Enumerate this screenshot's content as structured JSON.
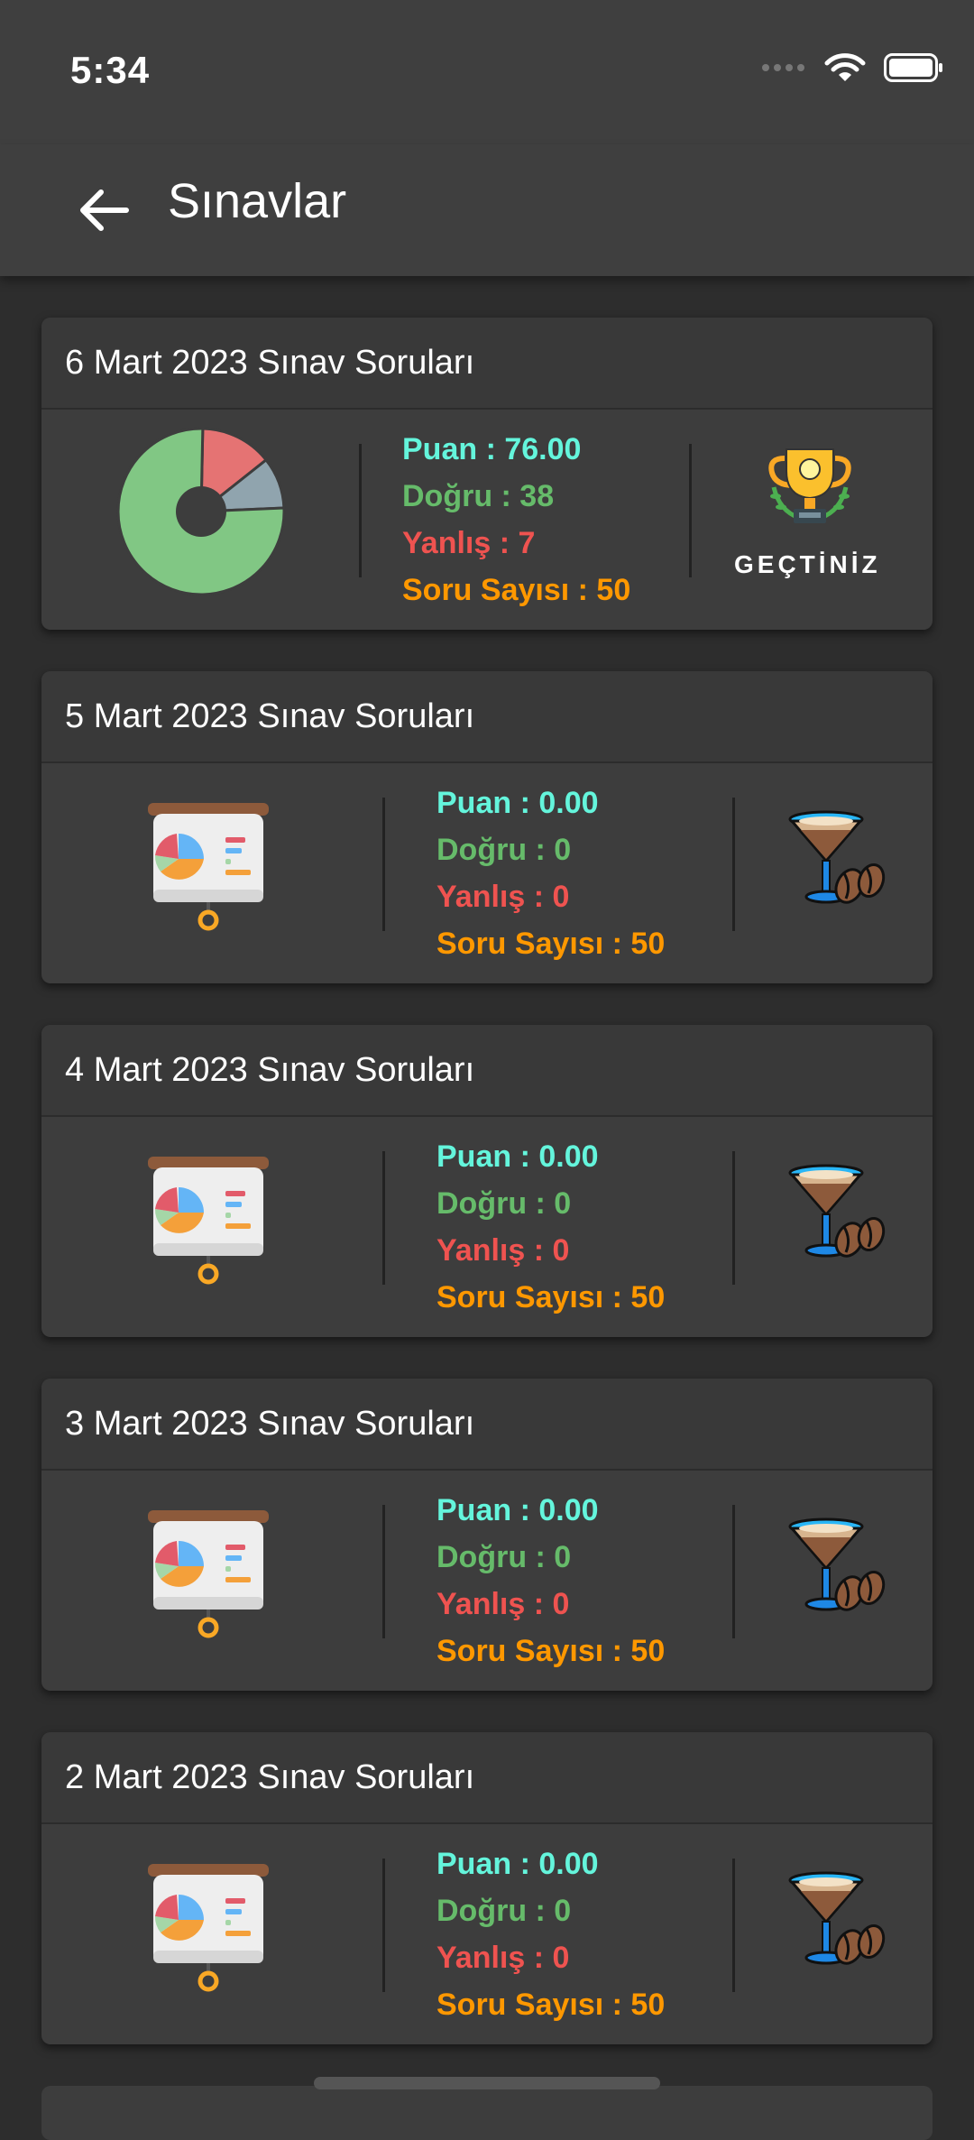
{
  "status_bar": {
    "time": "5:34",
    "signal_icon": "signal-dots-icon",
    "wifi_icon": "wifi-icon",
    "battery_icon": "battery-icon"
  },
  "app_bar": {
    "back_icon": "arrow-left-icon",
    "title": "Sınavlar"
  },
  "labels": {
    "puan": "Puan : ",
    "dogru": "Doğru : ",
    "yanlis": "Yanlış : ",
    "soru": "Soru Sayısı : "
  },
  "colors": {
    "puan": "#64f5dc",
    "dogru": "#66bb6a",
    "yanlis": "#ef5350",
    "soru": "#ff9800"
  },
  "exams": [
    {
      "title": "6 Mart 2023 Sınav Soruları",
      "puan": "Puan : 76.00",
      "dogru": "Doğru : 38",
      "yanlis": "Yanlış : 7",
      "soru": "Soru Sayısı : 50",
      "status": "GEÇTİNİZ",
      "left_icon": "pie-chart-icon",
      "right_icon": "trophy-icon",
      "chart_values": {
        "dogru": 38,
        "yanlis": 7,
        "bos": 5
      }
    },
    {
      "title": "5 Mart 2023 Sınav Soruları",
      "puan": "Puan : 0.00",
      "dogru": "Doğru : 0",
      "yanlis": "Yanlış : 0",
      "soru": "Soru Sayısı : 50",
      "status": "",
      "left_icon": "presentation-board-icon",
      "right_icon": "espresso-martini-icon"
    },
    {
      "title": "4 Mart 2023 Sınav Soruları",
      "puan": "Puan : 0.00",
      "dogru": "Doğru : 0",
      "yanlis": "Yanlış : 0",
      "soru": "Soru Sayısı : 50",
      "status": "",
      "left_icon": "presentation-board-icon",
      "right_icon": "espresso-martini-icon"
    },
    {
      "title": "3 Mart 2023 Sınav Soruları",
      "puan": "Puan : 0.00",
      "dogru": "Doğru : 0",
      "yanlis": "Yanlış : 0",
      "soru": "Soru Sayısı : 50",
      "status": "",
      "left_icon": "presentation-board-icon",
      "right_icon": "espresso-martini-icon"
    },
    {
      "title": "2 Mart 2023 Sınav Soruları",
      "puan": "Puan : 0.00",
      "dogru": "Doğru : 0",
      "yanlis": "Yanlış : 0",
      "soru": "Soru Sayısı : 50",
      "status": "",
      "left_icon": "presentation-board-icon",
      "right_icon": "espresso-martini-icon"
    }
  ]
}
